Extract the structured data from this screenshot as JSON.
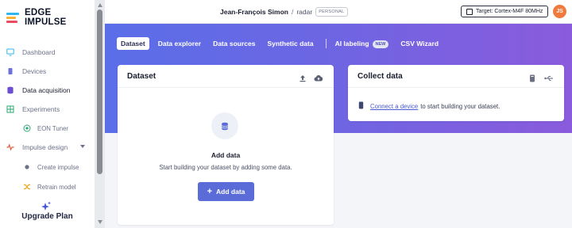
{
  "sidebar": {
    "logo_text": "EDGE IMPULSE",
    "items": [
      {
        "label": "Dashboard",
        "icon": "monitor-icon"
      },
      {
        "label": "Devices",
        "icon": "chip-icon"
      },
      {
        "label": "Data acquisition",
        "icon": "database-icon"
      },
      {
        "label": "Experiments",
        "icon": "grid-icon"
      },
      {
        "label": "EON Tuner",
        "icon": "target-icon"
      },
      {
        "label": "Impulse design",
        "icon": "pulse-icon"
      },
      {
        "label": "Create impulse",
        "icon": "dot-icon"
      },
      {
        "label": "Retrain model",
        "icon": "shuffle-icon"
      }
    ],
    "upgrade_label": "Upgrade Plan"
  },
  "topbar": {
    "owner": "Jean-François Simon",
    "separator": "/",
    "project": "radar",
    "badge": "PERSONAL",
    "target": "Target: Cortex-M4F 80MHz",
    "avatar_initials": "JS"
  },
  "tabs": [
    {
      "label": "Dataset"
    },
    {
      "label": "Data explorer"
    },
    {
      "label": "Data sources"
    },
    {
      "label": "Synthetic data"
    },
    {
      "label": "AI labeling",
      "badge": "NEW"
    },
    {
      "label": "CSV Wizard"
    }
  ],
  "dataset_card": {
    "title": "Dataset",
    "empty_title": "Add data",
    "empty_subtitle": "Start building your dataset by adding some data.",
    "add_button": "Add data"
  },
  "collect_card": {
    "title": "Collect data",
    "link_text": "Connect a device",
    "rest_text": "to start building your dataset."
  },
  "colors": {
    "accent": "#5b6cd8",
    "band_start": "#5a6ee8",
    "band_end": "#8a5bdc",
    "avatar": "#f07a3e"
  }
}
